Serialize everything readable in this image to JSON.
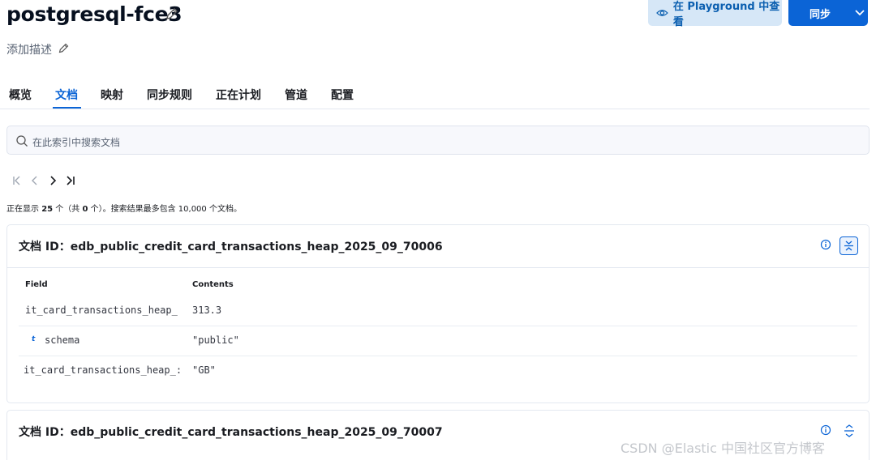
{
  "header": {
    "title": "postgresql-fce3",
    "description": "添加描述",
    "playground_button": "在 Playground 中查看",
    "sync_button": "同步"
  },
  "tabs": [
    {
      "label": "概览",
      "active": false
    },
    {
      "label": "文档",
      "active": true
    },
    {
      "label": "映射",
      "active": false
    },
    {
      "label": "同步规则",
      "active": false
    },
    {
      "label": "正在计划",
      "active": false
    },
    {
      "label": "管道",
      "active": false
    },
    {
      "label": "配置",
      "active": false
    }
  ],
  "search": {
    "placeholder": "在此索引中搜索文档"
  },
  "pagination": {
    "prefix": "正在显示 ",
    "count": "25",
    "mid": " 个（共 ",
    "total": "0",
    "suffix": " 个）。搜索结果最多包含 10,000 个文档。"
  },
  "documents": [
    {
      "title": "文档 ID：edb_public_credit_card_transactions_heap_2025_09_70006",
      "headers": {
        "field": "Field",
        "contents": "Contents"
      },
      "rows": [
        {
          "field": "it_card_transactions_heap_",
          "value": "313.3"
        },
        {
          "field": "schema",
          "type": "t",
          "value": "\"public\""
        },
        {
          "field": "it_card_transactions_heap_:",
          "value": "\"GB\""
        }
      ]
    },
    {
      "title": "文档 ID：edb_public_credit_card_transactions_heap_2025_09_70007"
    }
  ],
  "watermark": "CSDN @Elastic 中国社区官方博客",
  "colors": {
    "accent": "#0b64d6",
    "accent_light": "#d6e7f7",
    "border": "#e3e8f0",
    "text": "#1a1c21"
  }
}
